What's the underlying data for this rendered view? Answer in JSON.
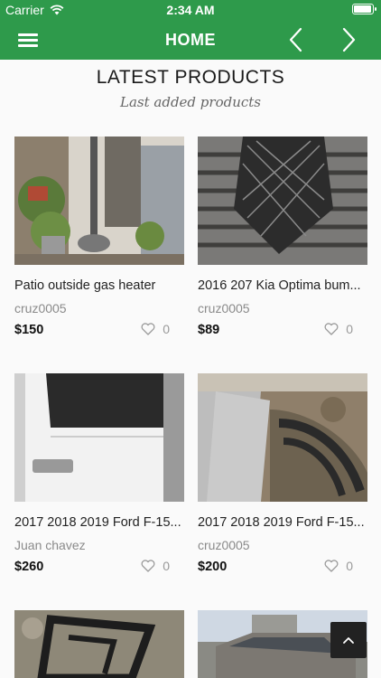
{
  "status_bar": {
    "carrier": "Carrier",
    "time": "2:34 AM",
    "battery_level": 1.0
  },
  "header": {
    "title": "HOME",
    "menu_icon": "hamburger-icon",
    "back_icon": "chevron-left-icon",
    "forward_icon": "chevron-right-icon",
    "color": "#2e9a4b"
  },
  "section": {
    "title": "LATEST PRODUCTS",
    "subtitle": "Last added products"
  },
  "products": [
    {
      "name": "Patio outside gas heater",
      "seller": "cruz0005",
      "price": "$150",
      "likes": "0"
    },
    {
      "name": "2016 207 Kia Optima bum...",
      "seller": "cruz0005",
      "price": "$89",
      "likes": "0"
    },
    {
      "name": "2017 2018 2019 Ford F-15...",
      "seller": "Juan chavez",
      "price": "$260",
      "likes": "0"
    },
    {
      "name": "2017 2018 2019 Ford F-15...",
      "seller": "cruz0005",
      "price": "$200",
      "likes": "0"
    }
  ],
  "scroll_top": {
    "icon": "chevron-up-icon"
  }
}
